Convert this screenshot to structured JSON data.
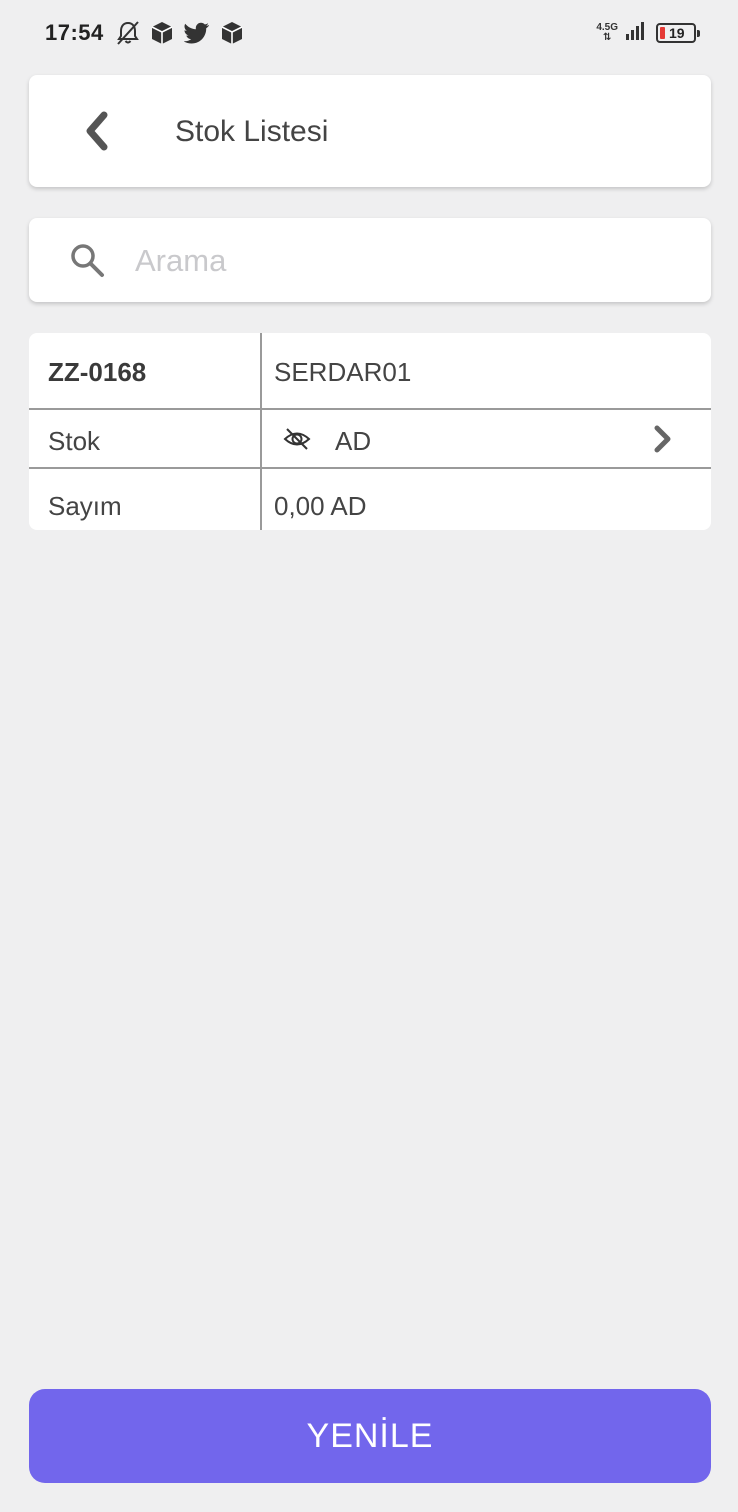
{
  "status_bar": {
    "time": "17:54",
    "network": "4.5G",
    "battery": "19",
    "icons": [
      "bell-off-icon",
      "package-icon",
      "twitter-icon",
      "package-icon",
      "signal-icon",
      "battery-icon"
    ],
    "battery_low_color": "#e53935"
  },
  "header": {
    "title": "Stok Listesi",
    "back_icon": "chevron-left-icon"
  },
  "search": {
    "placeholder": "Arama",
    "value": ""
  },
  "stock": {
    "code": "ZZ-0168",
    "name": "SERDAR01",
    "stok_label": "Stok",
    "stok_unit": "AD",
    "stok_icon": "eye-off-icon",
    "sayim_label": "Sayım",
    "sayim_value": "0,00 AD"
  },
  "actions": {
    "refresh_label": "YENİLE"
  },
  "colors": {
    "background": "#efeff0",
    "accent": "#7266ec",
    "card": "#ffffff",
    "divider": "#9a9a9a"
  }
}
